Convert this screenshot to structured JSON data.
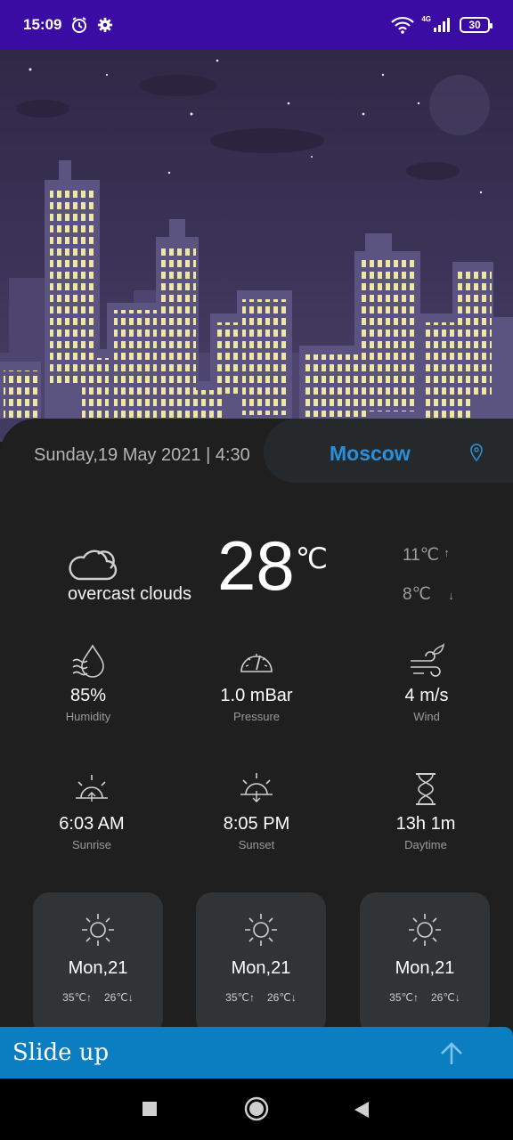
{
  "status_bar": {
    "time": "15:09",
    "network_label": "4G",
    "battery": "30"
  },
  "location": {
    "date_time": "Sunday,19 May 2021 | 4:30",
    "city": "Moscow"
  },
  "current": {
    "temperature": "28",
    "unit": "℃",
    "description": "overcast clouds",
    "high": "11℃",
    "low": "8℃"
  },
  "stats": {
    "humidity": {
      "value": "85%",
      "label": "Humidity"
    },
    "pressure": {
      "value": "1.0 mBar",
      "label": "Pressure"
    },
    "wind": {
      "value": "4 m/s",
      "label": "Wind"
    },
    "sunrise": {
      "value": "6:03 AM",
      "label": "Sunrise"
    },
    "sunset": {
      "value": "8:05 PM",
      "label": "Sunset"
    },
    "daytime": {
      "value": "13h 1m",
      "label": "Daytime"
    }
  },
  "forecast": [
    {
      "day": "Mon,21",
      "high": "35℃",
      "low": "26℃"
    },
    {
      "day": "Mon,21",
      "high": "35℃",
      "low": "26℃"
    },
    {
      "day": "Mon,21",
      "high": "35℃",
      "low": "26℃"
    }
  ],
  "slide_up": {
    "label": "Slide up"
  },
  "colors": {
    "status_bar": "#3a0ca3",
    "accent": "#2a8fd8",
    "slide_bar": "#0b7ec1",
    "card_bg": "#1f1f1f",
    "forecast_bg": "#313436"
  }
}
